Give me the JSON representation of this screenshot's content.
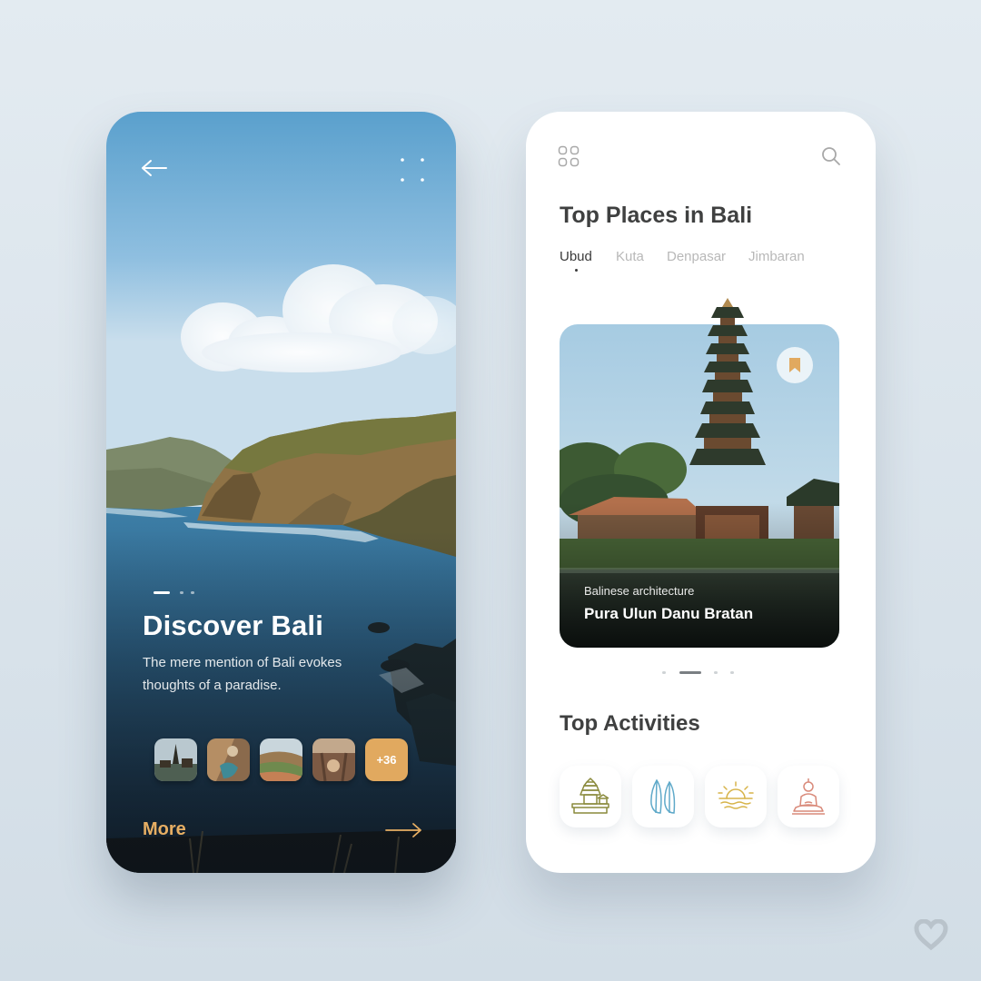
{
  "left_screen": {
    "title": "Discover Bali",
    "description": "The mere mention of Bali evokes thoughts of a paradise.",
    "thumbnails": [
      {
        "name": "temple-thumb"
      },
      {
        "name": "cliff-thumb"
      },
      {
        "name": "rice-terrace-thumb"
      },
      {
        "name": "swing-thumb"
      }
    ],
    "extra_count": "+36",
    "more_label": "More",
    "accent_color": "#e1a95f",
    "pager": {
      "pages": 3,
      "active": 0
    }
  },
  "right_screen": {
    "heading": "Top Places in Bali",
    "tabs": [
      {
        "label": "Ubud",
        "active": true
      },
      {
        "label": "Kuta",
        "active": false
      },
      {
        "label": "Denpasar",
        "active": false
      },
      {
        "label": "Jimbaran",
        "active": false
      }
    ],
    "featured": {
      "kicker": "Balinese architecture",
      "title": "Pura Ulun Danu Bratan",
      "bookmark_icon": "bookmark-icon"
    },
    "pager": {
      "pages": 4,
      "active": 1
    },
    "activities_heading": "Top Activities",
    "activities": [
      {
        "icon": "temple-icon",
        "color": "#8a8a3c"
      },
      {
        "icon": "surfboard-icon",
        "color": "#5fa9c9"
      },
      {
        "icon": "sunset-icon",
        "color": "#d7b44a"
      },
      {
        "icon": "buddha-icon",
        "color": "#d98a7a"
      }
    ]
  }
}
